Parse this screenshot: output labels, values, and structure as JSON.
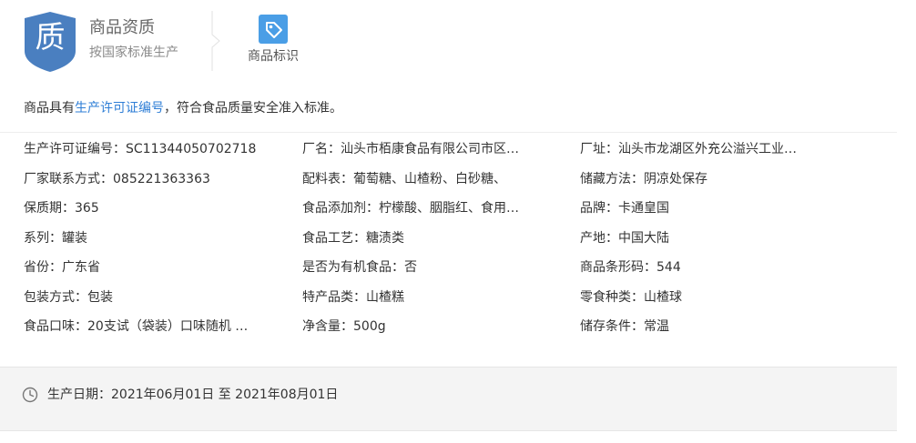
{
  "header": {
    "badge_char": "质",
    "title": "商品资质",
    "subtitle": "按国家标准生产",
    "tab_label": "商品标识",
    "tab_icon": "tag-icon"
  },
  "notice": {
    "prefix": "商品具有",
    "link": "生产许可证编号",
    "suffix": "，符合食品质量安全准入标准。"
  },
  "specs": [
    [
      "生产许可证编号：SC11344050702718",
      "厂名：汕头市栢康食品有限公司市区…",
      "厂址：汕头市龙湖区外充公溢兴工业…"
    ],
    [
      "厂家联系方式：085221363363",
      "配料表：葡萄糖、山楂粉、白砂糖、",
      "储藏方法：阴凉处保存"
    ],
    [
      "保质期：365",
      "食品添加剂：柠檬酸、胭脂红、食用…",
      "品牌：卡通皇国"
    ],
    [
      "系列：罐装",
      "食品工艺：糖渍类",
      "产地：中国大陆"
    ],
    [
      "省份：广东省",
      "是否为有机食品：否",
      "商品条形码：544"
    ],
    [
      "包装方式：包装",
      "特产品类：山楂糕",
      "零食种类：山楂球"
    ],
    [
      "食品口味：20支试（袋装）口味随机 …",
      "净含量：500g",
      "储存条件：常温"
    ]
  ],
  "production_date": "生产日期：2021年06月01日 至 2021年08月01日",
  "colors": {
    "badge": "#4a7fc0",
    "link": "#2e7ed6",
    "tab_icon": "#4a9ee6"
  }
}
